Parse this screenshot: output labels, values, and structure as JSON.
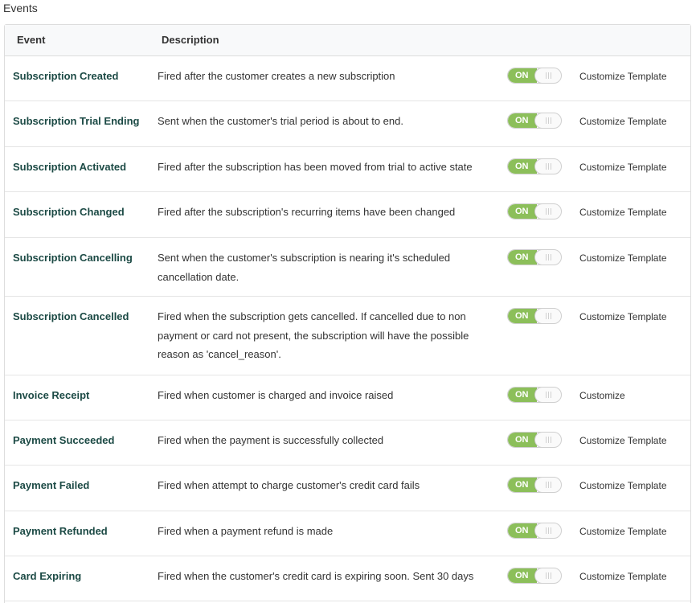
{
  "section_title": "Events",
  "table": {
    "headers": {
      "event": "Event",
      "description": "Description"
    },
    "rows": [
      {
        "event": "Subscription Created",
        "description": "Fired after the customer creates a new subscription",
        "toggle": "ON",
        "action": "Customize Template"
      },
      {
        "event": "Subscription Trial Ending",
        "description": "Sent when the customer's trial period is about to end.",
        "toggle": "ON",
        "action": "Customize Template"
      },
      {
        "event": "Subscription Activated",
        "description": "Fired after the subscription has been moved from trial to active state",
        "toggle": "ON",
        "action": "Customize Template"
      },
      {
        "event": "Subscription Changed",
        "description": "Fired after the subscription's recurring items have been changed",
        "toggle": "ON",
        "action": "Customize Template"
      },
      {
        "event": "Subscription Cancelling",
        "description": "Sent when the customer's subscription is nearing it's scheduled cancellation date.",
        "toggle": "ON",
        "action": "Customize Template"
      },
      {
        "event": "Subscription Cancelled",
        "description": "Fired when the subscription gets cancelled. If cancelled due to non payment or card not present, the subscription will have the possible reason as 'cancel_reason'.",
        "toggle": "ON",
        "action": "Customize Template"
      },
      {
        "event": "Invoice Receipt",
        "description": "Fired when customer is charged and invoice raised",
        "toggle": "ON",
        "action": "Customize"
      },
      {
        "event": "Payment Succeeded",
        "description": "Fired when the payment is successfully collected",
        "toggle": "ON",
        "action": "Customize Template"
      },
      {
        "event": "Payment Failed",
        "description": "Fired when attempt to charge customer's credit card fails",
        "toggle": "ON",
        "action": "Customize Template"
      },
      {
        "event": "Payment Refunded",
        "description": "Fired when a payment refund is made",
        "toggle": "ON",
        "action": "Customize Template"
      },
      {
        "event": "Card Expiring",
        "description": "Fired when the customer's credit card is expiring soon. Sent 30 days",
        "toggle": "ON",
        "action": "Customize Template"
      }
    ]
  },
  "colors": {
    "event_name": "#1c4a45",
    "toggle_on": "#8cbf5a",
    "header_bg": "#f8f9fa"
  }
}
